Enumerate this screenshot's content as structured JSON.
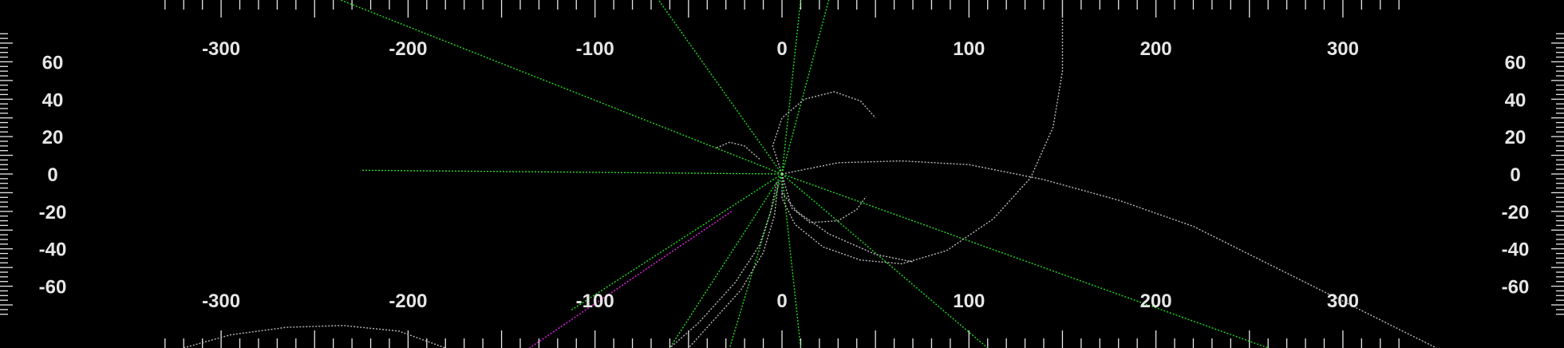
{
  "chart_data": {
    "type": "line",
    "title": "",
    "xlabel": "",
    "ylabel": "",
    "xlim": [
      -418,
      418
    ],
    "ylim": [
      -93,
      93
    ],
    "x_tick_labels": [
      "-300",
      "-200",
      "-100",
      "0",
      "100",
      "200",
      "300"
    ],
    "y_tick_labels": [
      "60",
      "40",
      "20",
      "0",
      "-20",
      "-40",
      "-60"
    ],
    "x_ticks": [
      -300,
      -200,
      -100,
      0,
      100,
      200,
      300
    ],
    "y_ticks": [
      60,
      40,
      20,
      0,
      -20,
      -40,
      -60
    ],
    "grid": false,
    "legend": "none",
    "colors": {
      "background": "#000000",
      "ticks": "#e6e6e6",
      "green": "#22dd22",
      "gray": "#bbbbbb",
      "magenta": "#ee22ee"
    },
    "series": [
      {
        "style": "green",
        "points": [
          [
            0,
            0
          ],
          [
            -236,
            93
          ]
        ]
      },
      {
        "style": "green",
        "points": [
          [
            0,
            0
          ],
          [
            -66,
            93
          ]
        ]
      },
      {
        "style": "green",
        "points": [
          [
            0,
            0
          ],
          [
            10,
            93
          ]
        ]
      },
      {
        "style": "green",
        "points": [
          [
            0,
            0
          ],
          [
            25,
            93
          ]
        ]
      },
      {
        "style": "green",
        "points": [
          [
            0,
            0
          ],
          [
            -225,
            2
          ]
        ]
      },
      {
        "style": "green",
        "points": [
          [
            0,
            0
          ],
          [
            260,
            -93
          ]
        ]
      },
      {
        "style": "green",
        "points": [
          [
            0,
            0
          ],
          [
            110,
            -93
          ]
        ]
      },
      {
        "style": "green",
        "points": [
          [
            0,
            0
          ],
          [
            10,
            -93
          ]
        ]
      },
      {
        "style": "green",
        "points": [
          [
            0,
            0
          ],
          [
            -28,
            -93
          ]
        ]
      },
      {
        "style": "green",
        "points": [
          [
            0,
            0
          ],
          [
            -60,
            -93
          ]
        ]
      },
      {
        "style": "green",
        "points": [
          [
            0,
            0
          ],
          [
            -113,
            -73
          ]
        ]
      },
      {
        "style": "magenta",
        "points": [
          [
            -27,
            -20
          ],
          [
            -135,
            -93
          ]
        ]
      },
      {
        "style": "gray",
        "points": [
          [
            0,
            0
          ],
          [
            30,
            6
          ],
          [
            64,
            7
          ],
          [
            100,
            5
          ],
          [
            140,
            -3
          ],
          [
            180,
            -14
          ],
          [
            220,
            -28
          ],
          [
            260,
            -48
          ],
          [
            300,
            -68
          ],
          [
            330,
            -83
          ],
          [
            350,
            -93
          ]
        ]
      },
      {
        "style": "gray",
        "points": [
          [
            -320,
            -93
          ],
          [
            -295,
            -86
          ],
          [
            -265,
            -82
          ],
          [
            -235,
            -81
          ],
          [
            -205,
            -84
          ],
          [
            -180,
            -93
          ]
        ]
      },
      {
        "style": "gray",
        "points": [
          [
            150,
            93
          ],
          [
            150,
            55
          ],
          [
            145,
            25
          ],
          [
            133,
            -2
          ],
          [
            113,
            -24
          ],
          [
            88,
            -41
          ],
          [
            64,
            -48
          ],
          [
            42,
            -46
          ],
          [
            22,
            -39
          ],
          [
            7,
            -27
          ],
          [
            0,
            -13
          ],
          [
            0,
            0
          ]
        ]
      },
      {
        "style": "gray",
        "points": [
          [
            -12,
            8
          ],
          [
            -20,
            15
          ],
          [
            -28,
            17
          ],
          [
            -35,
            14
          ]
        ]
      },
      {
        "style": "gray",
        "points": [
          [
            0,
            0
          ],
          [
            -5,
            15
          ],
          [
            0,
            30
          ],
          [
            12,
            40
          ],
          [
            28,
            44
          ],
          [
            42,
            39
          ],
          [
            50,
            30
          ]
        ]
      },
      {
        "style": "gray",
        "points": [
          [
            0,
            0
          ],
          [
            5,
            -18
          ],
          [
            15,
            -26
          ],
          [
            30,
            -25
          ],
          [
            40,
            -19
          ],
          [
            45,
            -12
          ]
        ]
      },
      {
        "style": "gray",
        "points": [
          [
            -3,
            -5
          ],
          [
            -6,
            -20
          ],
          [
            -12,
            -38
          ],
          [
            -25,
            -58
          ],
          [
            -45,
            -80
          ],
          [
            -60,
            -93
          ]
        ]
      },
      {
        "style": "gray",
        "points": [
          [
            -2,
            -4
          ],
          [
            -4,
            -22
          ],
          [
            -10,
            -42
          ],
          [
            -22,
            -62
          ],
          [
            -40,
            -82
          ],
          [
            -50,
            -93
          ]
        ]
      },
      {
        "style": "gray",
        "points": [
          [
            0,
            -10
          ],
          [
            8,
            -20
          ],
          [
            25,
            -32
          ],
          [
            50,
            -43
          ],
          [
            70,
            -47
          ]
        ]
      }
    ]
  }
}
